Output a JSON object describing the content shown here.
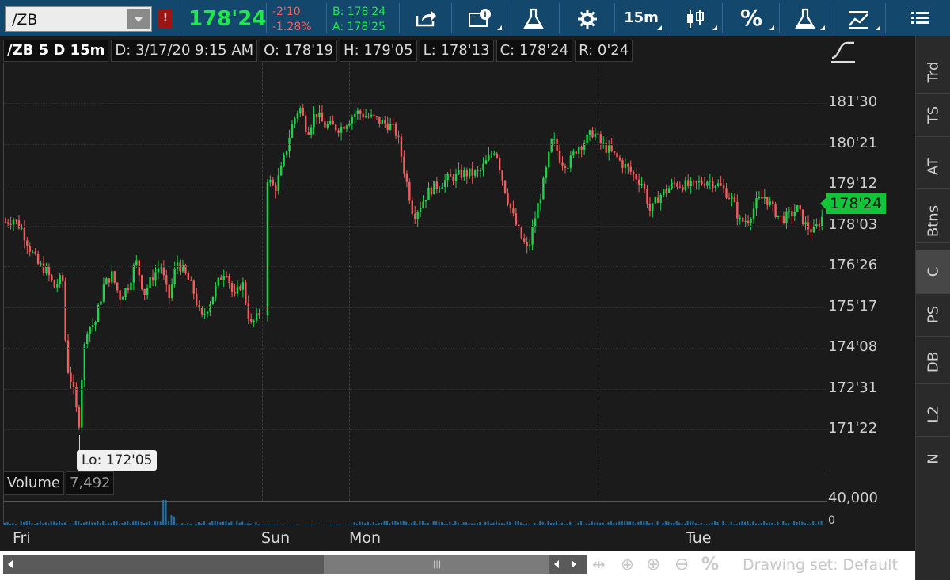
{
  "header": {
    "symbol": "/ZB",
    "alert_badge": "!",
    "last_price": "178'24",
    "change": "-2'10",
    "change_pct": "-1.28%",
    "bid": "B: 178'24",
    "ask": "A: 178'25",
    "aggregation": "15m",
    "percent_label": "%"
  },
  "chart": {
    "info": {
      "symbol_period": "/ZB 5 D 15m",
      "date": "D: 3/17/20 9:15 AM",
      "open": "O: 178'19",
      "high": "H: 179'05",
      "low": "L: 178'13",
      "close": "C: 178'24",
      "range": "R: 0'24"
    },
    "y_ticks": [
      "181'30",
      "180'21",
      "179'12",
      "178'03",
      "176'26",
      "175'17",
      "174'08",
      "172'31",
      "171'22"
    ],
    "current_price_tag": "178'24",
    "low_label": "Lo: 172'05",
    "x_ticks": [
      "Fri",
      "Sun",
      "Mon",
      "Tue"
    ]
  },
  "volume": {
    "label": "Volume",
    "value": "7,492",
    "axis_ticks": [
      "40,000",
      "0"
    ]
  },
  "right_tabs": [
    "Trd",
    "TS",
    "AT",
    "Btns",
    "C",
    "PS",
    "DB",
    "L2",
    "N"
  ],
  "active_tab": "C",
  "bottom": {
    "drawing_set": "Drawing set: Default",
    "percent_label": "%"
  },
  "colors": {
    "up": "#1ed34a",
    "down": "#f25c5c",
    "toolbar": "#13476b",
    "price_tag": "#14c438",
    "volume": "#1f6fa8"
  },
  "price_series": [
    [
      0,
      178.6
    ],
    [
      0.01,
      178.7
    ],
    [
      0.02,
      178.4
    ],
    [
      0.03,
      177.8
    ],
    [
      0.04,
      177.3
    ],
    [
      0.05,
      177.1
    ],
    [
      0.06,
      176.6
    ],
    [
      0.07,
      176.9
    ],
    [
      0.075,
      174.2
    ],
    [
      0.082,
      173.6
    ],
    [
      0.09,
      172.3
    ],
    [
      0.095,
      174.4
    ],
    [
      0.1,
      175.3
    ],
    [
      0.11,
      175.5
    ],
    [
      0.12,
      176.6
    ],
    [
      0.13,
      177.0
    ],
    [
      0.14,
      176.3
    ],
    [
      0.15,
      176.6
    ],
    [
      0.16,
      177.4
    ],
    [
      0.17,
      176.4
    ],
    [
      0.18,
      176.9
    ],
    [
      0.19,
      177.3
    ],
    [
      0.2,
      176.2
    ],
    [
      0.21,
      177.4
    ],
    [
      0.22,
      177.0
    ],
    [
      0.23,
      176.5
    ],
    [
      0.24,
      175.6
    ],
    [
      0.25,
      176.1
    ],
    [
      0.26,
      176.7
    ],
    [
      0.27,
      177.2
    ],
    [
      0.28,
      176.2
    ],
    [
      0.29,
      176.8
    ],
    [
      0.3,
      175.4
    ],
    [
      0.31,
      175.7
    ],
    [
      0.315,
      176.2
    ],
    [
      0.32,
      180.0
    ],
    [
      0.33,
      179.6
    ],
    [
      0.34,
      180.4
    ],
    [
      0.35,
      181.5
    ],
    [
      0.36,
      182.2
    ],
    [
      0.37,
      181.4
    ],
    [
      0.38,
      182.0
    ],
    [
      0.39,
      181.6
    ],
    [
      0.41,
      181.5
    ],
    [
      0.43,
      182.0
    ],
    [
      0.45,
      181.8
    ],
    [
      0.47,
      181.6
    ],
    [
      0.48,
      181.3
    ],
    [
      0.49,
      180.0
    ],
    [
      0.5,
      178.8
    ],
    [
      0.52,
      179.6
    ],
    [
      0.54,
      179.9
    ],
    [
      0.56,
      180.1
    ],
    [
      0.58,
      180.1
    ],
    [
      0.6,
      180.9
    ],
    [
      0.61,
      179.8
    ],
    [
      0.62,
      178.9
    ],
    [
      0.63,
      178.2
    ],
    [
      0.64,
      177.7
    ],
    [
      0.65,
      178.9
    ],
    [
      0.66,
      179.9
    ],
    [
      0.67,
      181.2
    ],
    [
      0.68,
      180.5
    ],
    [
      0.69,
      180.4
    ],
    [
      0.7,
      180.9
    ],
    [
      0.71,
      181.1
    ],
    [
      0.72,
      181.4
    ],
    [
      0.73,
      181.0
    ],
    [
      0.74,
      180.8
    ],
    [
      0.76,
      180.3
    ],
    [
      0.78,
      179.8
    ],
    [
      0.79,
      178.9
    ],
    [
      0.8,
      179.4
    ],
    [
      0.82,
      179.8
    ],
    [
      0.84,
      179.7
    ],
    [
      0.86,
      179.9
    ],
    [
      0.87,
      179.8
    ],
    [
      0.88,
      179.6
    ],
    [
      0.89,
      179.3
    ],
    [
      0.9,
      178.6
    ],
    [
      0.91,
      178.7
    ],
    [
      0.92,
      179.2
    ],
    [
      0.93,
      179.4
    ],
    [
      0.94,
      179.0
    ],
    [
      0.95,
      178.7
    ],
    [
      0.96,
      178.8
    ],
    [
      0.97,
      179.0
    ],
    [
      0.98,
      178.5
    ],
    [
      0.99,
      178.3
    ],
    [
      1.0,
      178.75
    ]
  ],
  "price_range": [
    170.0,
    183.5
  ]
}
